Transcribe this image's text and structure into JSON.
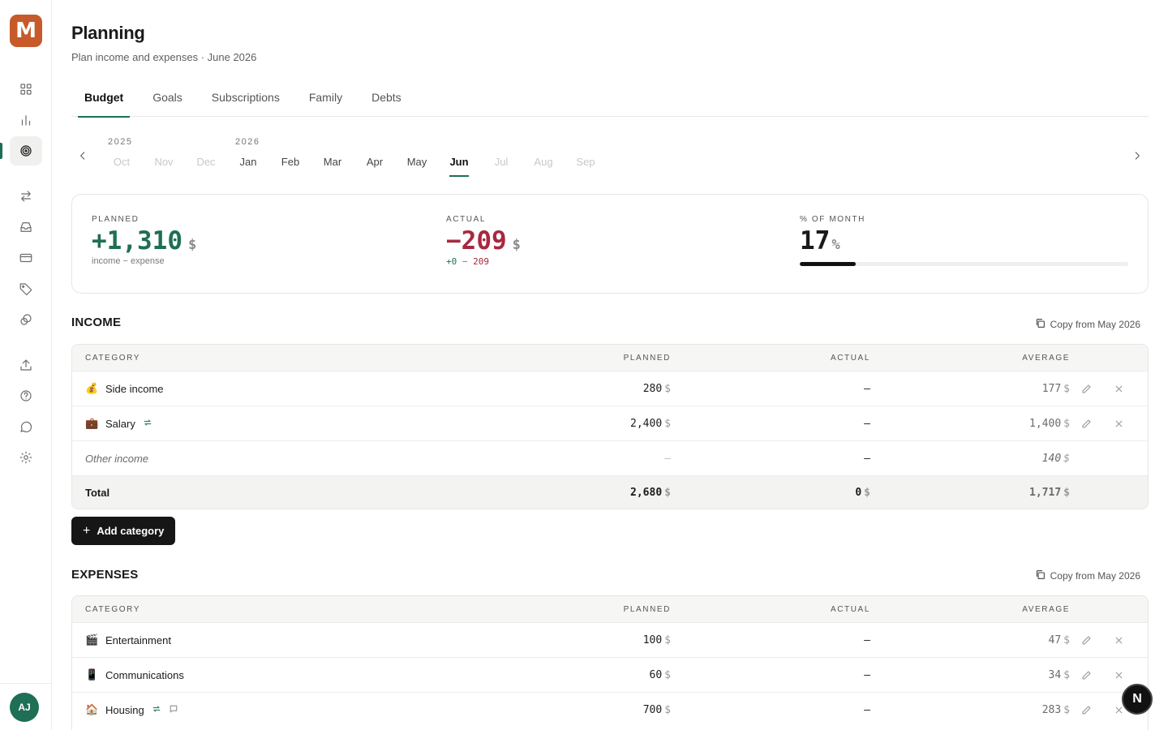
{
  "app": {
    "logo_letter": "M"
  },
  "sidebar": {
    "items": [
      {
        "icon": "dashboard-icon"
      },
      {
        "icon": "bar-chart-icon"
      },
      {
        "icon": "target-icon",
        "active": true
      },
      {
        "icon": "transfer-icon"
      },
      {
        "icon": "inbox-icon"
      },
      {
        "icon": "credit-card-icon"
      },
      {
        "icon": "tag-icon"
      },
      {
        "icon": "coins-icon"
      },
      {
        "icon": "upload-icon"
      },
      {
        "icon": "help-icon"
      },
      {
        "icon": "chat-icon"
      },
      {
        "icon": "settings-icon"
      }
    ],
    "avatar": "AJ"
  },
  "header": {
    "title": "Planning",
    "subtitle": "Plan income and expenses · June 2026"
  },
  "tabs": [
    {
      "label": "Budget",
      "active": true
    },
    {
      "label": "Goals"
    },
    {
      "label": "Subscriptions"
    },
    {
      "label": "Family"
    },
    {
      "label": "Debts"
    }
  ],
  "months": {
    "year1": "2025",
    "year2": "2026",
    "items": [
      {
        "label": "Oct",
        "dim": true
      },
      {
        "label": "Nov",
        "dim": true
      },
      {
        "label": "Dec",
        "dim": true
      },
      {
        "label": "Jan"
      },
      {
        "label": "Feb"
      },
      {
        "label": "Mar"
      },
      {
        "label": "Apr"
      },
      {
        "label": "May"
      },
      {
        "label": "Jun",
        "active": true
      },
      {
        "label": "Jul",
        "dim": true
      },
      {
        "label": "Aug",
        "dim": true
      },
      {
        "label": "Sep",
        "dim": true
      }
    ]
  },
  "summary": {
    "planned": {
      "label": "PLANNED",
      "value": "+1,310",
      "currency": "$",
      "note": "income − expense"
    },
    "actual": {
      "label": "ACTUAL",
      "value": "−209",
      "currency": "$",
      "note_pos": "+0",
      "note_sep": " − ",
      "note_neg": "209"
    },
    "percent": {
      "label": "% OF MONTH",
      "value": "17",
      "unit": "%",
      "progress": 0.17
    }
  },
  "income": {
    "title": "INCOME",
    "copy_label": "Copy from May 2026",
    "columns": {
      "category": "CATEGORY",
      "planned": "PLANNED",
      "actual": "ACTUAL",
      "average": "AVERAGE"
    },
    "rows": [
      {
        "emoji": "💰",
        "name": "Side income",
        "planned": "280",
        "actual": "—",
        "average": "177"
      },
      {
        "emoji": "💼",
        "name": "Salary",
        "planned": "2,400",
        "actual": "—",
        "average": "1,400",
        "recurring": true
      },
      {
        "name": "Other income",
        "planned": "—",
        "actual": "—",
        "average": "140",
        "other": true
      }
    ],
    "total": {
      "label": "Total",
      "planned": "2,680",
      "actual": "0",
      "average": "1,717"
    },
    "currency": "$"
  },
  "add_category_label": "Add category",
  "expenses": {
    "title": "EXPENSES",
    "copy_label": "Copy from May 2026",
    "columns": {
      "category": "CATEGORY",
      "planned": "PLANNED",
      "actual": "ACTUAL",
      "average": "AVERAGE"
    },
    "rows": [
      {
        "emoji": "🎬",
        "name": "Entertainment",
        "planned": "100",
        "actual": "—",
        "average": "47"
      },
      {
        "emoji": "📱",
        "name": "Communications",
        "planned": "60",
        "actual": "—",
        "average": "34"
      },
      {
        "emoji": "🏠",
        "name": "Housing",
        "planned": "700",
        "actual": "—",
        "average": "283",
        "recurring": true,
        "comment": true
      }
    ]
  },
  "fab_label": "N"
}
